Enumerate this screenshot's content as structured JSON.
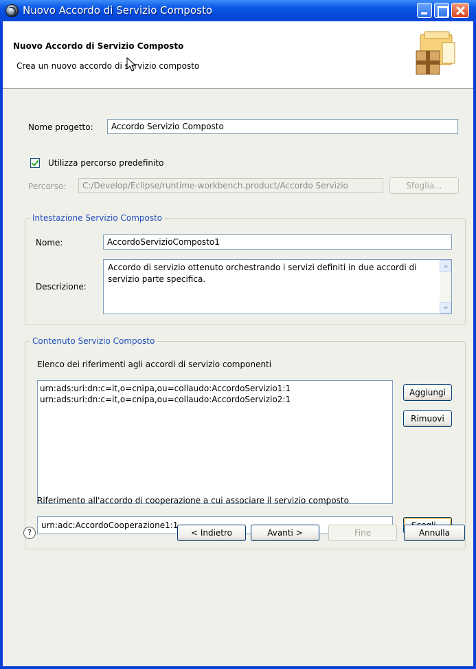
{
  "window": {
    "title": "Nuovo Accordo di Servizio Composto"
  },
  "header": {
    "title": "Nuovo Accordo di Servizio Composto",
    "description": "Crea un nuovo accordo di servizio composto",
    "icon": "package-wizard-icon"
  },
  "project": {
    "name_label": "Nome progetto:",
    "name_value": "Accordo Servizio Composto",
    "use_default_label": "Utilizza percorso predefinito",
    "use_default_checked": true,
    "path_label": "Percorso:",
    "path_value": "C:/Develop/Eclipse/runtime-workbench.product/Accordo Servizio",
    "browse_label": "Sfoglia..."
  },
  "header_group": {
    "legend": "Intestazione Servizio Composto",
    "name_label": "Nome:",
    "name_value": "AccordoServizioComposto1",
    "description_label": "Descrizione:",
    "description_value": "Accordo di servizio ottenuto orchestrando i servizi definiti in due accordi di servizio parte specifica."
  },
  "content_group": {
    "legend": "Contenuto Servizio Composto",
    "list_label": "Elenco dei riferimenti agli accordi di servizio componenti",
    "list_items": [
      "urn:ads:uri:dn:c=it,o=cnipa,ou=collaudo:AccordoServizio1:1",
      "urn:ads:uri:dn:c=it,o=cnipa,ou=collaudo:AccordoServizio2:1"
    ],
    "add_label": "Aggiungi",
    "remove_label": "Rimuovi",
    "coop_label": "Riferimento all'accordo di cooperazione a cui associare il servizio composto",
    "coop_value": "urn:adc:AccordoCooperazione1:1",
    "choose_label": "Scegli..."
  },
  "footer": {
    "help_symbol": "?",
    "back_label": "< Indietro",
    "next_label": "Avanti >",
    "finish_label": "Fine",
    "cancel_label": "Annulla"
  },
  "colors": {
    "titlebar": "#0a5ae8",
    "group_legend": "#1f4fbf",
    "dialog_bg": "#f0f0ea"
  }
}
